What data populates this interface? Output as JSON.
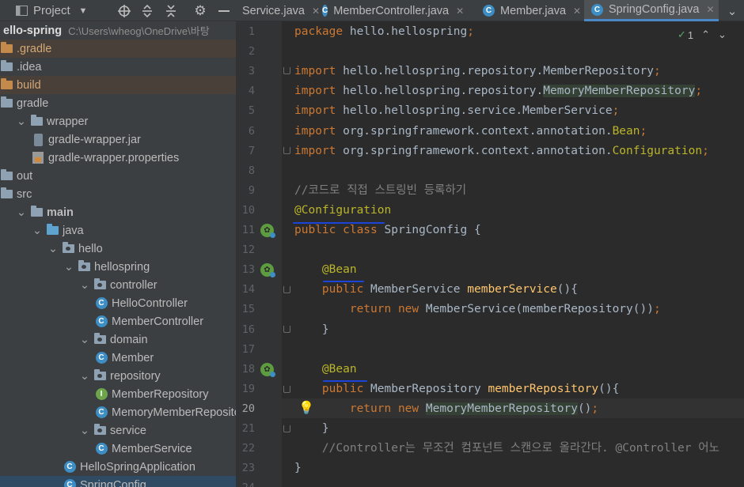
{
  "window": {
    "title": "hello-spring"
  },
  "project_toolbar": {
    "title": "Project",
    "dropdown": "chevron-down-icon",
    "icons": [
      "target-icon",
      "expand-all-icon",
      "collapse-all-icon",
      "gear-icon",
      "minimize-icon"
    ]
  },
  "tree": [
    {
      "label": "ello-spring",
      "path": "C:\\Users\\wheog\\OneDrive\\바탕",
      "type": "root"
    },
    {
      "label": ".gradle",
      "type": "folder-excluded"
    },
    {
      "label": ".idea",
      "type": "folder"
    },
    {
      "label": "build",
      "type": "folder-excluded"
    },
    {
      "label": "gradle",
      "type": "folder"
    },
    {
      "label": "wrapper",
      "type": "folder"
    },
    {
      "label": "gradle-wrapper.jar",
      "type": "jar"
    },
    {
      "label": "gradle-wrapper.properties",
      "type": "properties"
    },
    {
      "label": "out",
      "type": "folder-excluded-plain"
    },
    {
      "label": "src",
      "type": "folder"
    },
    {
      "label": "main",
      "type": "folder"
    },
    {
      "label": "java",
      "type": "source-root"
    },
    {
      "label": "hello",
      "type": "package"
    },
    {
      "label": "hellospring",
      "type": "package"
    },
    {
      "label": "controller",
      "type": "package"
    },
    {
      "label": "HelloController",
      "type": "class"
    },
    {
      "label": "MemberController",
      "type": "class"
    },
    {
      "label": "domain",
      "type": "package"
    },
    {
      "label": "Member",
      "type": "class"
    },
    {
      "label": "repository",
      "type": "package"
    },
    {
      "label": "MemberRepository",
      "type": "interface"
    },
    {
      "label": "MemoryMemberReposito",
      "type": "class"
    },
    {
      "label": "service",
      "type": "package"
    },
    {
      "label": "MemberService",
      "type": "class"
    },
    {
      "label": "HelloSpringApplication",
      "type": "class-app"
    },
    {
      "label": "SpringConfig",
      "type": "class",
      "selected": true
    }
  ],
  "tabs": [
    {
      "label": "Service.java",
      "active": false
    },
    {
      "label": "MemberController.java",
      "active": false
    },
    {
      "label": "Member.java",
      "active": false
    },
    {
      "label": "SpringConfig.java",
      "active": true
    }
  ],
  "tab_overflow_icon": "chevron-down-icon",
  "inspections": {
    "count": "1"
  },
  "editor": {
    "current_line": "20",
    "lines": [
      {
        "n": "1",
        "segs": [
          {
            "t": "package ",
            "c": "kw"
          },
          {
            "t": "hello.hellospring",
            "c": ""
          },
          {
            "t": ";",
            "c": "kw"
          }
        ]
      },
      {
        "n": "2",
        "segs": []
      },
      {
        "n": "3",
        "segs": [
          {
            "t": "import ",
            "c": "kw"
          },
          {
            "t": "hello.hellospring.repository.MemberRepository",
            "c": ""
          },
          {
            "t": ";",
            "c": "kw"
          }
        ]
      },
      {
        "n": "4",
        "segs": [
          {
            "t": "import ",
            "c": "kw"
          },
          {
            "t": "hello.hellospring.repository.",
            "c": ""
          },
          {
            "t": "MemoryMemberRepository",
            "c": "hl"
          },
          {
            "t": ";",
            "c": "kw"
          }
        ]
      },
      {
        "n": "5",
        "segs": [
          {
            "t": "import ",
            "c": "kw"
          },
          {
            "t": "hello.hellospring.service.MemberService",
            "c": ""
          },
          {
            "t": ";",
            "c": "kw"
          }
        ]
      },
      {
        "n": "6",
        "segs": [
          {
            "t": "import ",
            "c": "kw"
          },
          {
            "t": "org.springframework.context.annotation.",
            "c": ""
          },
          {
            "t": "Bean",
            "c": "ann"
          },
          {
            "t": ";",
            "c": "kw"
          }
        ]
      },
      {
        "n": "7",
        "segs": [
          {
            "t": "import ",
            "c": "kw"
          },
          {
            "t": "org.springframework.context.annotation.",
            "c": ""
          },
          {
            "t": "Configuration",
            "c": "ann"
          },
          {
            "t": ";",
            "c": "kw"
          }
        ]
      },
      {
        "n": "8",
        "segs": []
      },
      {
        "n": "9",
        "segs": [
          {
            "t": "//코드로 직접 스트링빈 등록하기",
            "c": "cmt"
          }
        ]
      },
      {
        "n": "10",
        "segs": [
          {
            "t": "@Configuration",
            "c": "ann"
          }
        ]
      },
      {
        "n": "11",
        "segs": [
          {
            "t": "public class ",
            "c": "kw"
          },
          {
            "t": "SpringConfig {",
            "c": ""
          }
        ]
      },
      {
        "n": "12",
        "segs": []
      },
      {
        "n": "13",
        "segs": [
          {
            "t": "    ",
            "c": ""
          },
          {
            "t": "@Bean",
            "c": "ann"
          }
        ]
      },
      {
        "n": "14",
        "segs": [
          {
            "t": "    ",
            "c": ""
          },
          {
            "t": "public ",
            "c": "kw"
          },
          {
            "t": "MemberService ",
            "c": ""
          },
          {
            "t": "memberService",
            "c": "fn"
          },
          {
            "t": "(){",
            "c": ""
          }
        ]
      },
      {
        "n": "15",
        "segs": [
          {
            "t": "        ",
            "c": ""
          },
          {
            "t": "return new ",
            "c": "kw"
          },
          {
            "t": "MemberService(memberRepository())",
            "c": ""
          },
          {
            "t": ";",
            "c": "kw"
          }
        ]
      },
      {
        "n": "16",
        "segs": [
          {
            "t": "    }",
            "c": ""
          }
        ]
      },
      {
        "n": "17",
        "segs": []
      },
      {
        "n": "18",
        "segs": [
          {
            "t": "    ",
            "c": ""
          },
          {
            "t": "@Bean",
            "c": "ann"
          }
        ]
      },
      {
        "n": "19",
        "segs": [
          {
            "t": "    ",
            "c": ""
          },
          {
            "t": "public ",
            "c": "kw"
          },
          {
            "t": "MemberRepository ",
            "c": ""
          },
          {
            "t": "memberRepository",
            "c": "fn"
          },
          {
            "t": "(){",
            "c": ""
          }
        ]
      },
      {
        "n": "20",
        "segs": [
          {
            "t": "        ",
            "c": ""
          },
          {
            "t": "return new ",
            "c": "kw"
          },
          {
            "t": "MemoryMemberRepository",
            "c": "hl"
          },
          {
            "t": "()",
            "c": ""
          },
          {
            "t": ";",
            "c": "kw"
          }
        ]
      },
      {
        "n": "21",
        "segs": [
          {
            "t": "    }",
            "c": ""
          }
        ]
      },
      {
        "n": "22",
        "segs": [
          {
            "t": "    //Controller는 무조건 컴포넌트 스캔으로 올라간다. @Controller 어노",
            "c": "cmt"
          }
        ]
      },
      {
        "n": "23",
        "segs": [
          {
            "t": "}",
            "c": ""
          }
        ]
      },
      {
        "n": "24",
        "segs": []
      }
    ]
  }
}
